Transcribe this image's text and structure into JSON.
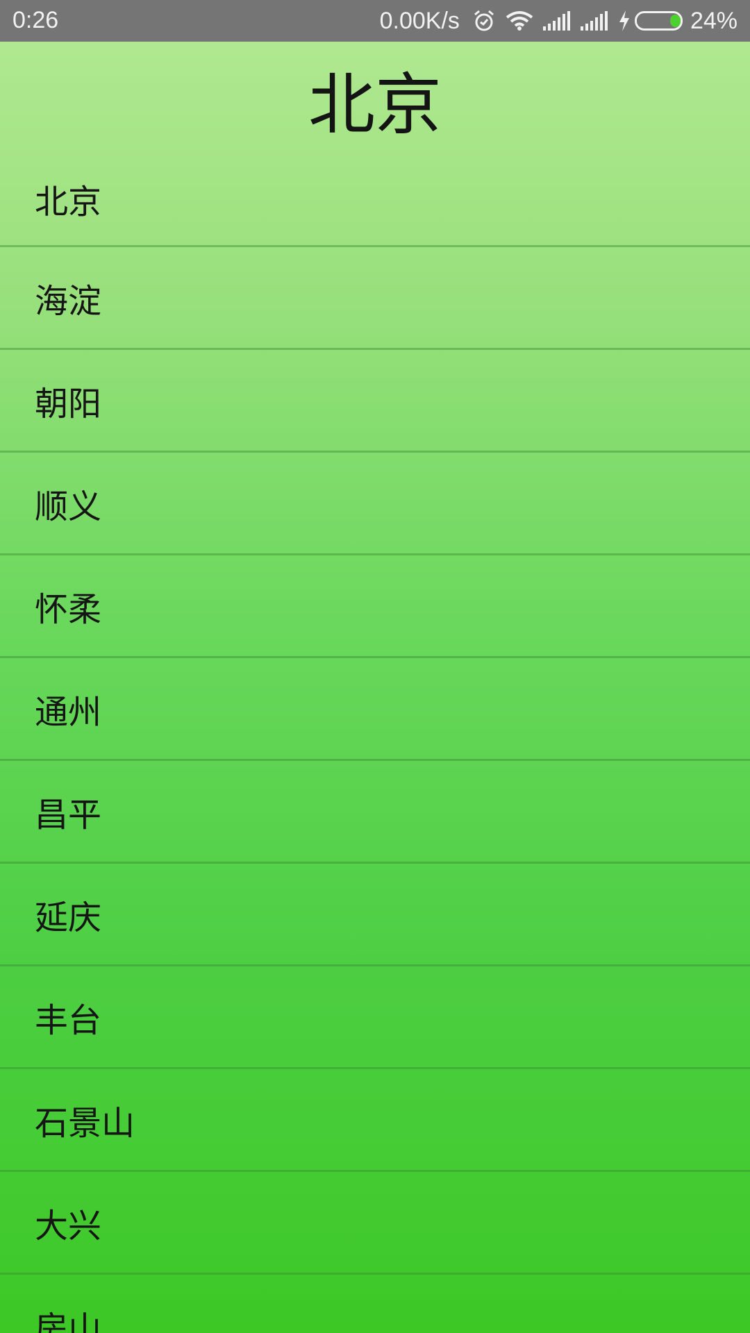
{
  "status_bar": {
    "time": "0:26",
    "net_speed": "0.00K/s",
    "battery_percent": "24%",
    "battery_level": 0.24,
    "icons": [
      "alarm-icon",
      "wifi-icon",
      "signal-icon",
      "signal-icon",
      "charging-icon",
      "battery-icon"
    ]
  },
  "header": {
    "title": "北京"
  },
  "cities": [
    {
      "label": "北京"
    },
    {
      "label": "海淀"
    },
    {
      "label": "朝阳"
    },
    {
      "label": "顺义"
    },
    {
      "label": "怀柔"
    },
    {
      "label": "通州"
    },
    {
      "label": "昌平"
    },
    {
      "label": "延庆"
    },
    {
      "label": "丰台"
    },
    {
      "label": "石景山"
    },
    {
      "label": "大兴"
    },
    {
      "label": "房山"
    }
  ],
  "colors": {
    "status_bar_bg": "#757575",
    "gradient_top": "#b0e890",
    "gradient_bottom": "#3dc826",
    "battery_fill": "#4cd130"
  }
}
